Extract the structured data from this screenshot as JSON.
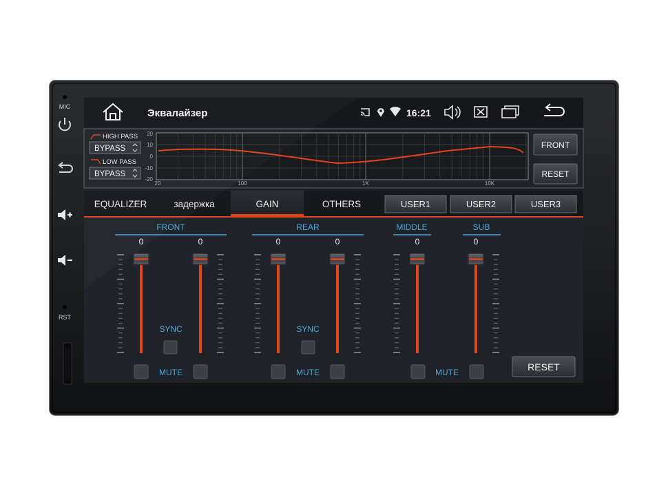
{
  "side_buttons": {
    "mic": "MIC",
    "rst": "RST",
    "power": "power-icon",
    "back": "back-arrow-icon",
    "vol_up": "volume-up-icon",
    "vol_down": "volume-down-icon"
  },
  "status_bar": {
    "title": "Эквалайзер",
    "time": "16:21",
    "icons": [
      "home-icon",
      "cast-icon",
      "location-icon",
      "wifi-icon",
      "speaker-icon",
      "close-box-icon",
      "recent-apps-icon",
      "back-icon"
    ]
  },
  "filters": {
    "high_pass_label": "HIGH PASS",
    "high_pass_value": "BYPASS",
    "low_pass_label": "LOW PASS",
    "low_pass_value": "BYPASS"
  },
  "graph": {
    "y_ticks": [
      "20",
      "10",
      "0",
      "-10",
      "-20"
    ],
    "x_ticks": [
      "20",
      "100",
      "1K",
      "10K"
    ]
  },
  "top_buttons": {
    "front": "FRONT",
    "reset": "RESET"
  },
  "tabs": [
    {
      "label": "EQUALIZER"
    },
    {
      "label": "задержка"
    },
    {
      "label": "GAIN",
      "active": true
    },
    {
      "label": "OTHERS"
    }
  ],
  "presets": [
    "USER1",
    "USER2",
    "USER3"
  ],
  "gain": {
    "groups": [
      {
        "label": "FRONT",
        "sync_label": "SYNC",
        "mute_label": "MUTE",
        "values": [
          "0",
          "0"
        ]
      },
      {
        "label": "REAR",
        "sync_label": "SYNC",
        "mute_label": "MUTE",
        "values": [
          "0",
          "0"
        ]
      },
      {
        "label": "MIDDLE",
        "values": [
          "0"
        ]
      },
      {
        "label": "SUB",
        "values": [
          "0"
        ]
      }
    ],
    "shared_mute_label": "MUTE",
    "reset_label": "RESET",
    "slider_level": 0.95
  },
  "colors": {
    "accent": "#e2441c",
    "header_blue": "#4aa8d8",
    "screen_bg": "#1c1f24",
    "panel_bg": "#23262b"
  }
}
